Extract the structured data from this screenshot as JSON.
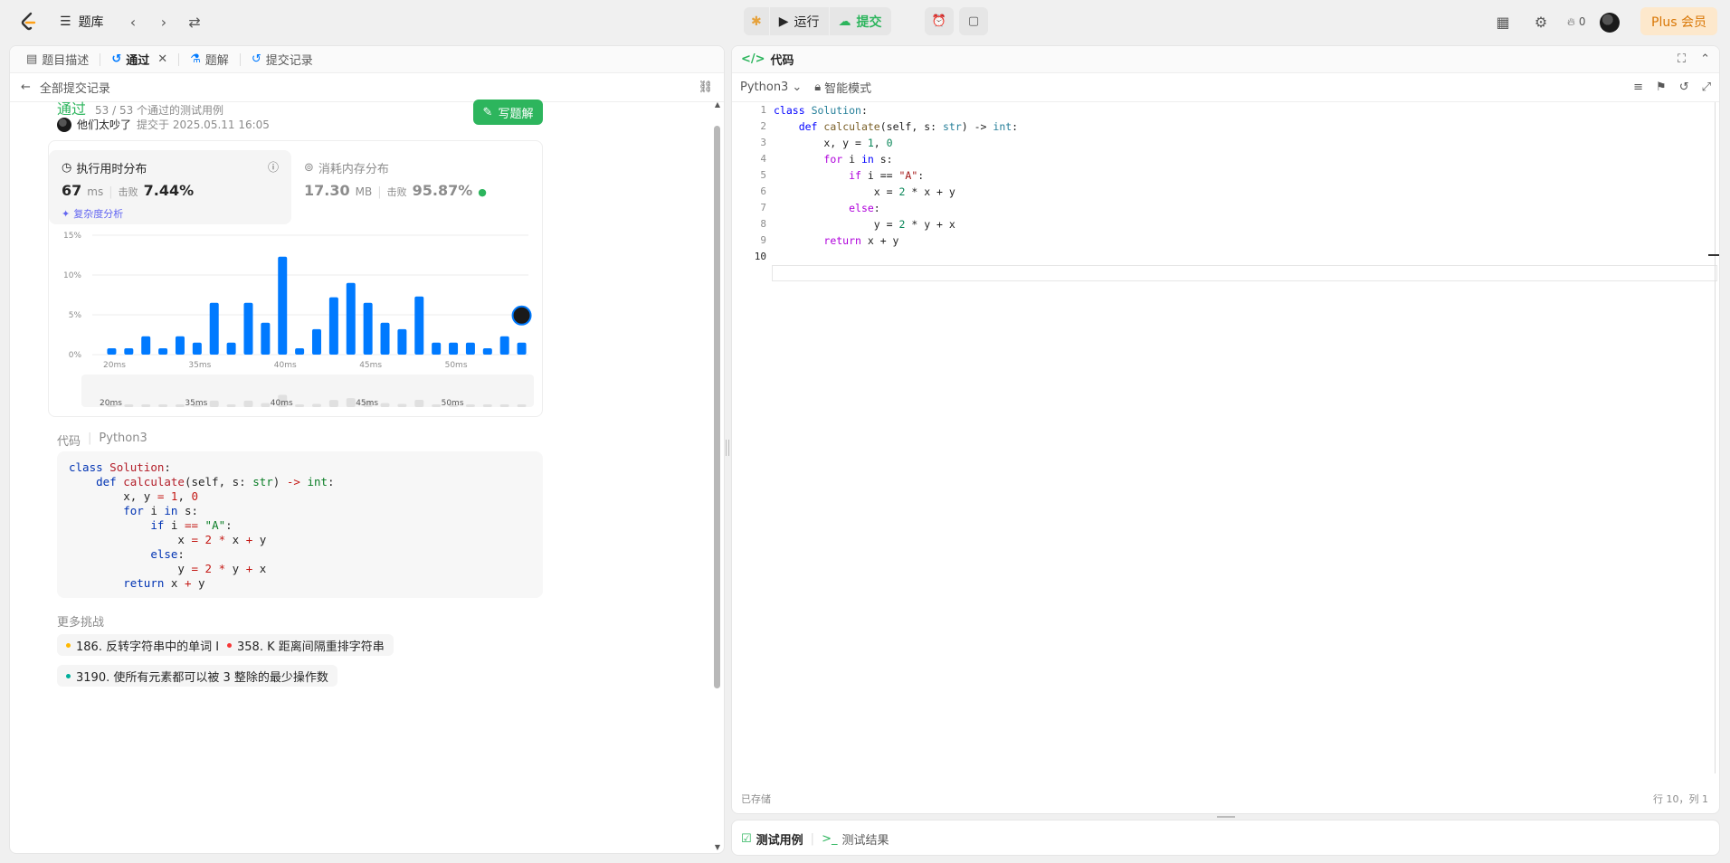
{
  "nav": {
    "problem_bank": "题库",
    "run": "运行",
    "submit": "提交",
    "streak": "0",
    "plus": "Plus 会员"
  },
  "left": {
    "tabs": [
      "题目描述",
      "通过",
      "题解",
      "提交记录"
    ],
    "back": "全部提交记录",
    "status": "通过",
    "cases": "53 / 53 个通过的测试用例",
    "author": "他们太吵了",
    "submitted": "提交于 2025.05.11 16:05",
    "write_solution": "写题解",
    "runtime_title": "执行用时分布",
    "runtime_value": "67",
    "runtime_unit": "ms",
    "beat_label": "击败",
    "runtime_beat": "7.44%",
    "complexity": "复杂度分析",
    "memory_title": "消耗内存分布",
    "memory_value": "17.30",
    "memory_unit": "MB",
    "memory_beat": "95.87%",
    "code_label": "代码",
    "code_lang": "Python3",
    "more_label": "更多挑战",
    "challenges": [
      {
        "text": "186. 反转字符串中的单词 II",
        "color": "#ffb800"
      },
      {
        "text": "358. K 距离间隔重排字符串",
        "color": "#f63636"
      },
      {
        "text": "3190. 使所有元素都可以被 3 整除的最少操作数",
        "color": "#00af9b"
      }
    ]
  },
  "chart_data": {
    "type": "bar",
    "ylabel_ticks": [
      "15%",
      "10%",
      "5%",
      "0%"
    ],
    "ylim": [
      0,
      15
    ],
    "x_ticks": [
      "20ms",
      "35ms",
      "40ms",
      "45ms",
      "50ms"
    ],
    "values": [
      0.8,
      0.8,
      2.3,
      0.8,
      2.3,
      1.5,
      6.5,
      1.5,
      6.5,
      4.0,
      12.3,
      0.8,
      3.2,
      7.2,
      9.0,
      6.5,
      4.0,
      3.2,
      7.3,
      1.5,
      1.5,
      1.5,
      0.8,
      2.3,
      1.5
    ],
    "highlight_index": 24,
    "bar_color": "#007aff"
  },
  "right": {
    "title": "代码",
    "lang": "Python3",
    "mode": "智能模式",
    "saved": "已存储",
    "position": "行 10，列 1",
    "bottom_tabs": [
      "测试用例",
      "测试结果"
    ],
    "line_numbers": [
      "1",
      "2",
      "3",
      "4",
      "5",
      "6",
      "7",
      "8",
      "9",
      "10"
    ]
  }
}
